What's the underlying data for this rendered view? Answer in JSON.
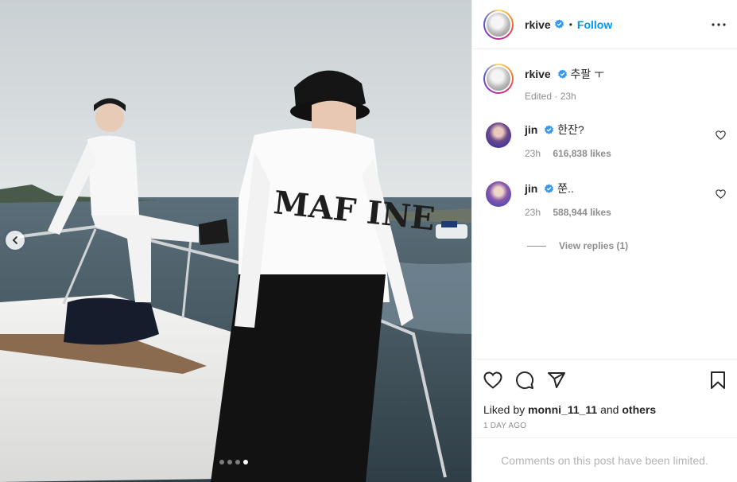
{
  "post": {
    "author": "rkive",
    "follow_label": "Follow",
    "separator": "•",
    "icons": {
      "verified": "verified-badge-icon",
      "more": "more-options-icon",
      "prev": "chevron-left-icon"
    },
    "media_slides_total": 4,
    "media_slide_active": 4
  },
  "caption": {
    "author": "rkive",
    "text": "추팔 ㅜ",
    "meta": "Edited · 23h"
  },
  "comments": [
    {
      "author": "jin",
      "text": "한잔?",
      "time": "23h",
      "likes": "616,838 likes"
    },
    {
      "author": "jin",
      "text": "쭌..",
      "time": "23h",
      "likes": "588,944 likes"
    }
  ],
  "view_replies": "View replies (1)",
  "actions": {
    "icons": [
      "heart-icon",
      "comment-icon",
      "share-icon",
      "bookmark-icon"
    ],
    "liked_prefix": "Liked by",
    "liked_user": "monni_11_11",
    "liked_and": "and",
    "liked_others": "others",
    "date": "1 DAY AGO"
  },
  "comments_limited": "Comments on this post have been limited.",
  "colors": {
    "link": "#0095f6",
    "text": "#262626",
    "muted": "#8e8e8e"
  }
}
